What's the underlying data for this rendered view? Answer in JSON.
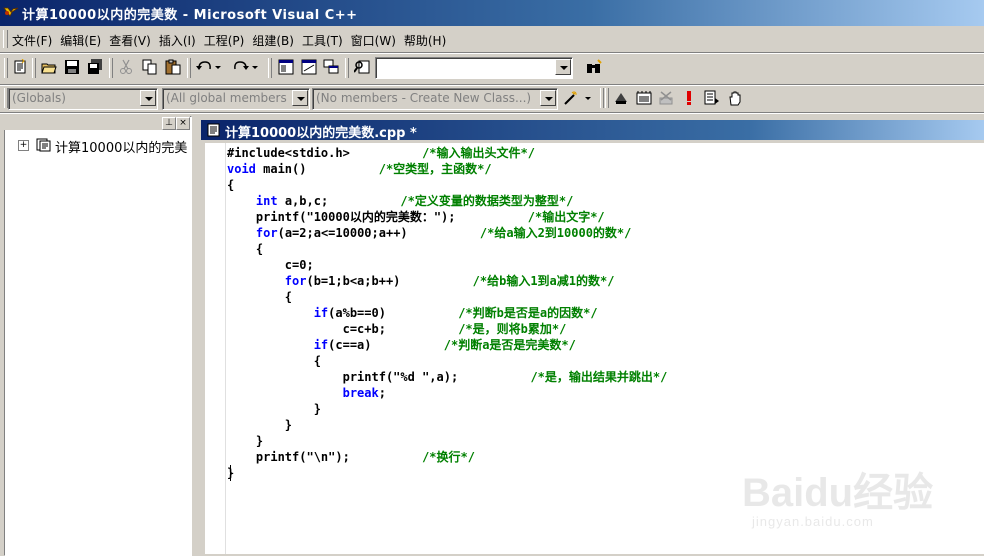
{
  "window": {
    "title": "计算10000以内的完美数 - Microsoft Visual C++"
  },
  "menu": {
    "items": [
      {
        "label": "文件(F)"
      },
      {
        "label": "编辑(E)"
      },
      {
        "label": "查看(V)"
      },
      {
        "label": "插入(I)"
      },
      {
        "label": "工程(P)"
      },
      {
        "label": "组建(B)"
      },
      {
        "label": "工具(T)"
      },
      {
        "label": "窗口(W)"
      },
      {
        "label": "帮助(H)"
      }
    ]
  },
  "toolbar": {
    "find_combo_value": ""
  },
  "wizardbar": {
    "class_combo": "(Globals)",
    "filter_combo": "(All global members",
    "members_combo": "(No members - Create New Class...)"
  },
  "workspace": {
    "tree_item": "计算10000以内的完美数"
  },
  "editor": {
    "tab_title": "计算10000以内的完美数.cpp *"
  },
  "code_lines": [
    [
      {
        "t": "",
        "s": "#include<stdio.h>"
      },
      {
        "t": "",
        "s": "          "
      },
      {
        "t": "cm",
        "s": "/*输入输出头文件*/"
      }
    ],
    [
      {
        "t": "kw",
        "s": "void"
      },
      {
        "t": "",
        "s": " main()          "
      },
      {
        "t": "cm",
        "s": "/*空类型，主函数*/"
      }
    ],
    [
      {
        "t": "",
        "s": "{"
      }
    ],
    [
      {
        "t": "",
        "s": "    "
      },
      {
        "t": "kw",
        "s": "int"
      },
      {
        "t": "",
        "s": " a,b,c;          "
      },
      {
        "t": "cm",
        "s": "/*定义变量的数据类型为整型*/"
      }
    ],
    [
      {
        "t": "",
        "s": "    printf(\"10000以内的完美数：\");          "
      },
      {
        "t": "cm",
        "s": "/*输出文字*/"
      }
    ],
    [
      {
        "t": "",
        "s": "    "
      },
      {
        "t": "kw",
        "s": "for"
      },
      {
        "t": "",
        "s": "(a=2;a<=10000;a++)          "
      },
      {
        "t": "cm",
        "s": "/*给a输入2到10000的数*/"
      }
    ],
    [
      {
        "t": "",
        "s": "    {"
      }
    ],
    [
      {
        "t": "",
        "s": "        c=0;"
      }
    ],
    [
      {
        "t": "",
        "s": "        "
      },
      {
        "t": "kw",
        "s": "for"
      },
      {
        "t": "",
        "s": "(b=1;b<a;b++)          "
      },
      {
        "t": "cm",
        "s": "/*给b输入1到a减1的数*/"
      }
    ],
    [
      {
        "t": "",
        "s": "        {"
      }
    ],
    [
      {
        "t": "",
        "s": "            "
      },
      {
        "t": "kw",
        "s": "if"
      },
      {
        "t": "",
        "s": "(a%b==0)          "
      },
      {
        "t": "cm",
        "s": "/*判断b是否是a的因数*/"
      }
    ],
    [
      {
        "t": "",
        "s": "                c=c+b;          "
      },
      {
        "t": "cm",
        "s": "/*是，则将b累加*/"
      }
    ],
    [
      {
        "t": "",
        "s": "            "
      },
      {
        "t": "kw",
        "s": "if"
      },
      {
        "t": "",
        "s": "(c==a)          "
      },
      {
        "t": "cm",
        "s": "/*判断a是否是完美数*/"
      }
    ],
    [
      {
        "t": "",
        "s": "            {"
      }
    ],
    [
      {
        "t": "",
        "s": "                printf(\"%d \",a);          "
      },
      {
        "t": "cm",
        "s": "/*是，输出结果并跳出*/"
      }
    ],
    [
      {
        "t": "",
        "s": "                "
      },
      {
        "t": "kw",
        "s": "break"
      },
      {
        "t": "",
        "s": ";"
      }
    ],
    [
      {
        "t": "",
        "s": "            }"
      }
    ],
    [
      {
        "t": "",
        "s": "        }"
      }
    ],
    [
      {
        "t": "",
        "s": "    }"
      }
    ],
    [
      {
        "t": "",
        "s": "    printf(\"\\n\");          "
      },
      {
        "t": "cm",
        "s": "/*换行*/"
      }
    ],
    [
      {
        "t": "",
        "s": "}"
      }
    ]
  ],
  "watermark": {
    "logo": "Baidu经验",
    "url": "jingyan.baidu.com"
  },
  "colors": {
    "title_bar": "#0a246a",
    "keyword": "#0000ff",
    "comment": "#008000",
    "chrome": "#d4d0c8"
  }
}
